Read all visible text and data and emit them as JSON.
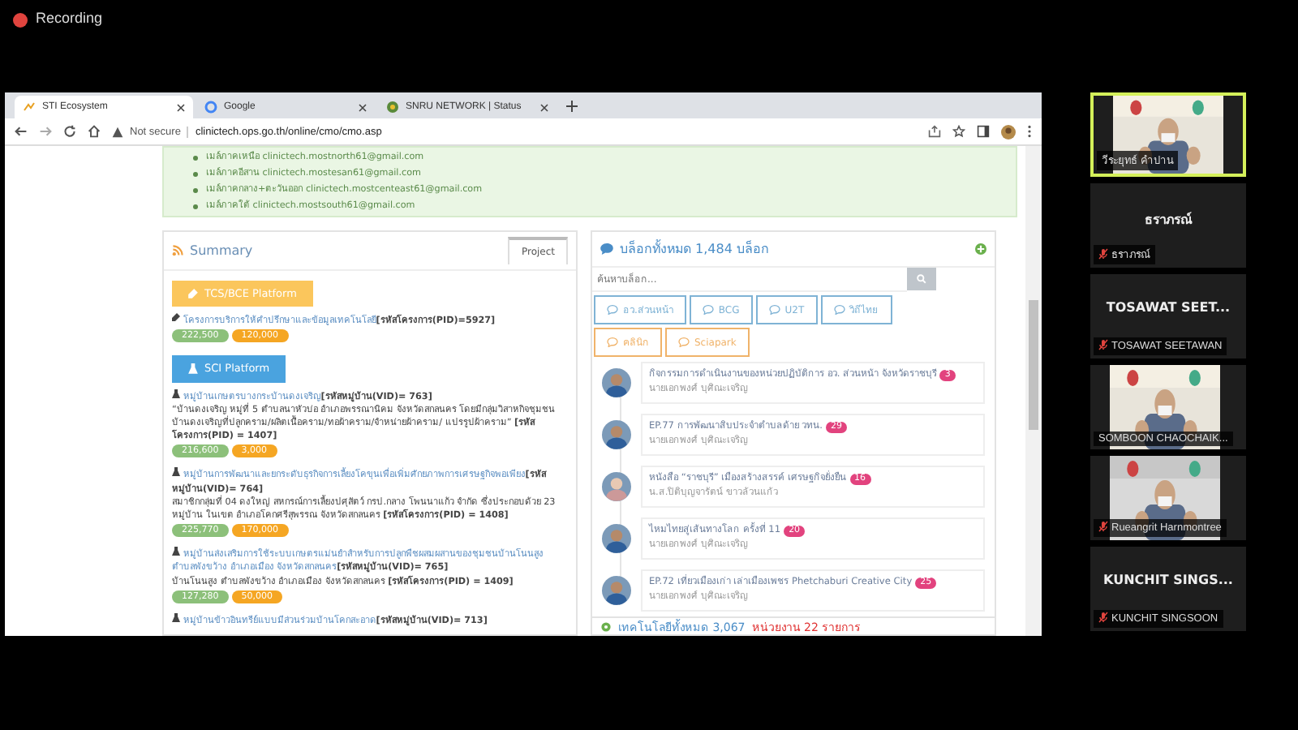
{
  "recording": {
    "label": "Recording"
  },
  "browser": {
    "tabs": [
      {
        "title": "STI Ecosystem",
        "selected": true
      },
      {
        "title": "Google",
        "selected": false
      },
      {
        "title": "SNRU NETWORK | Status",
        "selected": false
      }
    ],
    "security": "Not secure",
    "url": "clinictech.ops.go.th/online/cmo/cmo.asp"
  },
  "email_list": [
    "เมล์ภาคเหนือ clinictech.mostnorth61@gmail.com",
    "เมล์ภาคอีสาน clinictech.mostesan61@gmail.com",
    "เมล์ภาคกลาง+ตะวันออก clinictech.mostcenteast61@gmail.com",
    "เมล์ภาคใต้ clinictech.mostsouth61@gmail.com"
  ],
  "summary": {
    "title": "Summary",
    "tabs": [
      {
        "label": "Project",
        "selected": true
      }
    ],
    "platforms": [
      {
        "label": "TCS/BCE Platform",
        "kind": "tcs",
        "items": [
          {
            "link": "โครงการบริการให้คำปรึกษาและข้อมูลเทคโนโลยี",
            "code": "[รหัสโครงการ(PID)=5927]",
            "amounts": [
              {
                "text": "222,500",
                "color": "#8cc07a"
              },
              {
                "text": "120,000",
                "color": "#f5a623"
              }
            ]
          }
        ]
      },
      {
        "label": "SCI Platform",
        "kind": "sci",
        "items": [
          {
            "link": "หมู่บ้านเกษตรบางกระบ้านดงเจริญ",
            "code": "[รหัสหมู่บ้าน(VID)= 763]",
            "desc": "“บ้านดงเจริญ หมู่ที่ 5 ตำบลนาหัวบ่อ อำเภอพรรณานิคม จังหวัดสกลนคร โดยมีกลุ่มวิสาหกิจชุมชนบ้านดงเจริญที่ปลูกคราม/ผลิตเนื้อคราม/ทอผ้าคราม/จำหน่ายผ้าคราม/ แปรรูปผ้าคราม”",
            "pid": "[รหัสโครงการ(PID) = 1407]",
            "amounts": [
              {
                "text": "216,600",
                "color": "#8cc07a"
              },
              {
                "text": "3,000",
                "color": "#f5a623"
              }
            ]
          },
          {
            "link": "หมู่บ้านการพัฒนาและยกระดับธุรกิจการเลี้ยงโคขุนเพื่อเพิ่มศักยภาพการเศรษฐกิจพอเพียง",
            "code": "[รหัสหมู่บ้าน(VID)= 764]",
            "desc": "สมาชิกกลุ่มที่ 04 ดงใหญ่ สหกรณ์การเลี้ยงปศุสัตว์ กรป.กลาง โพนนาแก้ว จำกัด ซึ่งประกอบด้วย 23 หมู่บ้าน ในเขต อำเภอโคกศรีสุพรรณ จังหวัดสกลนคร",
            "pid": "[รหัสโครงการ(PID) = 1408]",
            "amounts": [
              {
                "text": "225,770",
                "color": "#8cc07a"
              },
              {
                "text": "170,000",
                "color": "#f5a623"
              }
            ]
          },
          {
            "link": "หมู่บ้านส่งเสริมการใช้ระบบเกษตรแม่นยำสำหรับการปลูกพืชผสมผสานของชุมชนบ้านโนนสูง ตำบลพังขว้าง อำเภอเมือง จังหวัดสกลนคร",
            "code": "[รหัสหมู่บ้าน(VID)= 765]",
            "desc": "บ้านโนนสูง ตำบลพังขว้าง อำเภอเมือง จังหวัดสกลนคร",
            "pid": "[รหัสโครงการ(PID) = 1409]",
            "amounts": [
              {
                "text": "127,280",
                "color": "#8cc07a"
              },
              {
                "text": "50,000",
                "color": "#f5a623"
              }
            ]
          },
          {
            "link": "หมู่บ้านข้าวอินทรีย์แบบมีส่วนร่วมบ้านโคกสะอาด",
            "code": "[รหัสหมู่บ้าน(VID)= 713]"
          }
        ]
      }
    ]
  },
  "blogs": {
    "title": "บล็อกทั้งหมด 1,484 บล็อก",
    "search": {
      "placeholder": "ค้นหาบล็อก..."
    },
    "filters": [
      {
        "label": "อว.ส่วนหน้า",
        "color": "#7fb3d5"
      },
      {
        "label": "BCG",
        "color": "#7fb3d5"
      },
      {
        "label": "U2T",
        "color": "#7fb3d5"
      },
      {
        "label": "วิถีไทย",
        "color": "#7fb3d5"
      },
      {
        "label": "คลินิก",
        "color": "#f0b36a"
      },
      {
        "label": "Sciapark",
        "color": "#f0b36a"
      }
    ],
    "posts": [
      {
        "title": "กิจกรรมการดำเนินงานของหน่วยปฏิบัติการ อว. ส่วนหน้า จังหวัดราชบุรี",
        "count": "3",
        "author": "นายเอกพงศ์ บุศิณะเจริญ",
        "kind": "man"
      },
      {
        "title": "EP.77 การพัฒนาสิบประจำตำบลด้าย วทน.",
        "count": "29",
        "author": "นายเอกพงศ์ บุศิณะเจริญ",
        "kind": "man"
      },
      {
        "title": "หนังสือ “ราชบุรี” เมืองสร้างสรรค์ เศรษฐกิจยั่งยืน",
        "count": "16",
        "author": "น.ส.ปิติบุญจารัตน์ ขาวล้วนแก้ว",
        "kind": "woman"
      },
      {
        "title": "ไหมไทยสู่เส้นทางโลก ครั้งที่ 11",
        "count": "20",
        "author": "นายเอกพงศ์ บุศิณะเจริญ",
        "kind": "man"
      },
      {
        "title": "EP.72 เที่ยวเมืองเก่า เล่าเมืองเพชร Phetchaburi Creative City",
        "count": "25",
        "author": "นายเอกพงศ์ บุศิณะเจริญ",
        "kind": "man"
      }
    ]
  },
  "technology": {
    "title": "เทคโนโลยีทั้งหมด 3,067",
    "agencies": "หน่วยงาน 22 รายการ"
  },
  "participants": [
    {
      "name": "วีระยุทธ์ คำปาน",
      "kind": "video",
      "muted": false,
      "speaking": true
    },
    {
      "display": "ธราภรณ์",
      "name": "ธราภรณ์",
      "kind": "name",
      "muted": true,
      "speaking": false
    },
    {
      "display": "TOSAWAT  SEET...",
      "name": "TOSAWAT SEETAWAN",
      "kind": "name",
      "muted": true,
      "speaking": false
    },
    {
      "name": "SOMBOON CHAOCHAIK...",
      "kind": "video",
      "muted": false,
      "speaking": false
    },
    {
      "name": "Rueangrit Harnmontree",
      "kind": "video",
      "muted": true,
      "speaking": false
    },
    {
      "display": "KUNCHIT  SINGS...",
      "name": "KUNCHIT SINGSOON",
      "kind": "name",
      "muted": true,
      "speaking": false
    }
  ]
}
